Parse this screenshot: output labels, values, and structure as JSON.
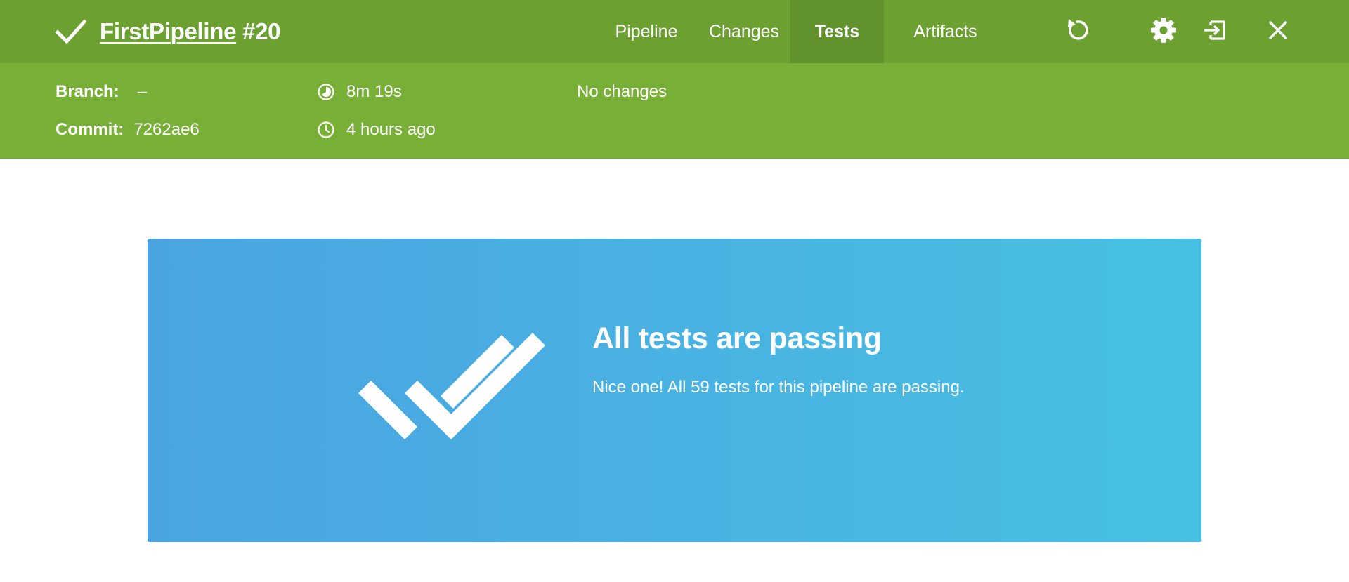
{
  "header": {
    "status_icon": "check-icon",
    "pipeline_name": "FirstPipeline",
    "run_number": "#20",
    "tabs": [
      {
        "label": "Pipeline",
        "active": false
      },
      {
        "label": "Changes",
        "active": false
      },
      {
        "label": "Tests",
        "active": true
      },
      {
        "label": "Artifacts",
        "active": false
      }
    ],
    "actions": [
      "replay-icon",
      "gear-icon",
      "exit-icon",
      "close-icon"
    ],
    "colors": {
      "bar": "#6ca132",
      "active_tab": "#61922c"
    }
  },
  "run_info": {
    "branch_label": "Branch:",
    "branch_value": "–",
    "commit_label": "Commit:",
    "commit_value": "7262ae6",
    "duration": "8m 19s",
    "duration_icon": "duration-icon",
    "started": "4 hours ago",
    "started_icon": "clock-icon",
    "changes": "No changes",
    "color": "#78b037"
  },
  "tests": {
    "icon": "double-check-icon",
    "heading": "All tests are passing",
    "message": "Nice one! All 59 tests for this pipeline are passing.",
    "gradient": [
      "#4aa4e0",
      "#47c0e3"
    ]
  }
}
